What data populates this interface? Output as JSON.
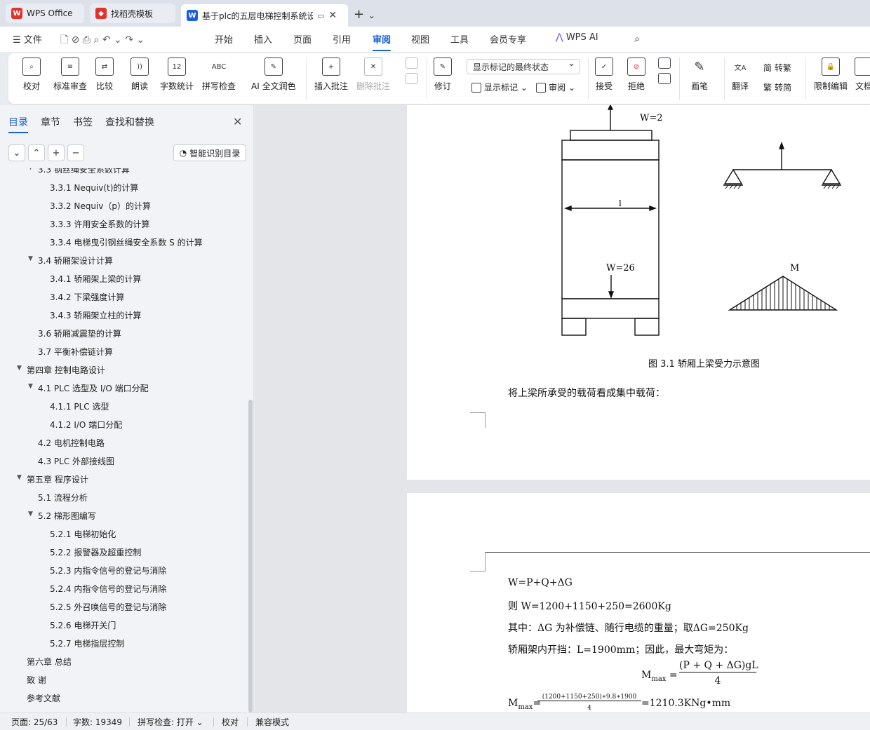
{
  "tabs": {
    "wps_office": "WPS Office",
    "templates": "找稻壳模板",
    "document": "基于plc的五层电梯控制系统设"
  },
  "menu": {
    "file": "文件",
    "items": [
      "开始",
      "插入",
      "页面",
      "引用",
      "审阅",
      "视图",
      "工具",
      "会员专享",
      "WPS AI"
    ]
  },
  "ribbon": {
    "proofread": "校对",
    "standard_review": "标准审查",
    "compare": "比较",
    "read_aloud": "朗读",
    "word_count": "字数统计",
    "spell_check": "拼写检查",
    "ai_polish": "AI 全文润色",
    "insert_comment": "插入批注",
    "delete_comment": "删除批注",
    "track_changes": "修订",
    "markup_state": "显示标记的最终状态",
    "show_markup": "显示标记",
    "review_pane": "审阅",
    "accept": "接受",
    "reject": "拒绝",
    "pen": "画笔",
    "translate": "翻译",
    "to_traditional": "转繁",
    "to_simplified": "转简",
    "restrict_edit": "限制编辑",
    "doc_more": "文档"
  },
  "nav": {
    "tabs": [
      "目录",
      "章节",
      "书签",
      "查找和替换"
    ],
    "smart_toc": "智能识别目录",
    "toc": [
      {
        "text": "3.3  钢丝绳安全系数计算",
        "level": 2,
        "arrow": true
      },
      {
        "text": "3.3.1 Nequiv(t)的计算",
        "level": 3
      },
      {
        "text": "3.3.2 Nequiv（p）的计算",
        "level": 3
      },
      {
        "text": "3.3.3 许用安全系数的计算",
        "level": 3
      },
      {
        "text": "3.3.4 电梯曳引钢丝绳安全系数 S 的计算",
        "level": 3
      },
      {
        "text": "3.4   轿厢架设计计算",
        "level": 2,
        "arrow": true
      },
      {
        "text": "3.4.1 轿厢架上梁的计算",
        "level": 3
      },
      {
        "text": "3.4.2 下梁强度计算",
        "level": 3
      },
      {
        "text": "3.4.3 轿厢架立柱的计算",
        "level": 3
      },
      {
        "text": "3.6 轿厢减震垫的计算",
        "level": 2
      },
      {
        "text": "3.7 平衡补偿链计算",
        "level": 2
      },
      {
        "text": "第四章   控制电路设计",
        "level": 1,
        "arrow": true
      },
      {
        "text": "4.1 PLC 选型及 I/O 端口分配",
        "level": 2,
        "arrow": true
      },
      {
        "text": "4.1.1 PLC 选型",
        "level": 3
      },
      {
        "text": "4.1.2 I/O 端口分配",
        "level": 3
      },
      {
        "text": "4.2  电机控制电路",
        "level": 2
      },
      {
        "text": "4.3 PLC 外部接线图",
        "level": 2
      },
      {
        "text": "第五章    程序设计",
        "level": 1,
        "arrow": true
      },
      {
        "text": "5.1  流程分析",
        "level": 2
      },
      {
        "text": "5.2  梯形图编写",
        "level": 2,
        "arrow": true
      },
      {
        "text": "5.2.1  电梯初始化",
        "level": 3
      },
      {
        "text": "5.2.2 报警器及超重控制",
        "level": 3
      },
      {
        "text": "5.2.3  内指令信号的登记与消除",
        "level": 3
      },
      {
        "text": "5.2.4 内指令信号的登记与消除",
        "level": 3
      },
      {
        "text": "5.2.5  外召唤信号的登记与消除",
        "level": 3
      },
      {
        "text": "5.2.6 电梯开关门",
        "level": 3
      },
      {
        "text": "5.2.7 电梯指层控制",
        "level": 3
      },
      {
        "text": "第六章    总结",
        "level": 1
      },
      {
        "text": "致   谢",
        "level": 1
      },
      {
        "text": "参考文献",
        "level": 1
      }
    ]
  },
  "document": {
    "fig_labels": {
      "w_top": "W=2",
      "span": "l",
      "w_bottom": "W=26",
      "moment": "M"
    },
    "figure_caption": "图 3.1 轿厢上梁受力示意图",
    "para1": "将上梁所承受的载荷看成集中载荷：",
    "eq1": "W=P+Q+ΔG",
    "eq2": "则 W=1200+1150+250=2600Kg",
    "eq3": "其中：ΔG 为补偿链、随行电缆的重量；取ΔG=250Kg",
    "eq4": "轿厢架内开挡：L=1900mm；因此，最大弯矩为：",
    "mmax_label": "M",
    "mmax_sub": "max",
    "mmax_numer": "(P + Q + ΔG)gL",
    "mmax_denom": "4",
    "calc_numer": "(1200+1150+250)∗9.8∗1900",
    "calc_denom": "4",
    "calc_result": "=1210.3KNg•mm"
  },
  "status": {
    "page": "页面: 25/63",
    "words": "字数: 19349",
    "spell": "拼写检查: 打开",
    "proof": "校对",
    "compat": "兼容模式"
  },
  "colors": {
    "accent": "#1a5fd3",
    "wps_red": "#e0332b"
  }
}
